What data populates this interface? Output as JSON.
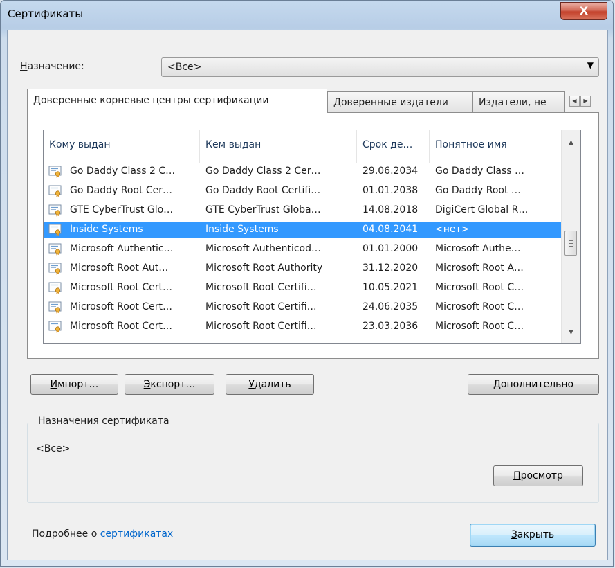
{
  "window": {
    "title": "Сертификаты",
    "close_label": "X"
  },
  "purpose": {
    "label_first": "Н",
    "label_rest": "азначение:",
    "selected": "<Все>"
  },
  "tabs": [
    {
      "label": "Доверенные корневые центры сертификации",
      "active": true
    },
    {
      "label": "Доверенные издатели",
      "active": false
    },
    {
      "label": "Издатели, не",
      "active": false
    }
  ],
  "list": {
    "columns": [
      "Кому выдан",
      "Кем выдан",
      "Срок де…",
      "Понятное имя"
    ],
    "rows": [
      {
        "issued_to": "Go Daddy Class 2 C…",
        "issued_by": "Go Daddy Class 2 Cer…",
        "expires": "29.06.2034",
        "name": "Go Daddy Class …",
        "selected": false
      },
      {
        "issued_to": "Go Daddy Root Cer…",
        "issued_by": "Go Daddy Root Certifi…",
        "expires": "01.01.2038",
        "name": "Go Daddy Root …",
        "selected": false
      },
      {
        "issued_to": "GTE CyberTrust Glo…",
        "issued_by": "GTE CyberTrust Globa…",
        "expires": "14.08.2018",
        "name": "DigiCert Global R…",
        "selected": false
      },
      {
        "issued_to": "Inside Systems",
        "issued_by": "Inside Systems",
        "expires": "04.08.2041",
        "name": "<нет>",
        "selected": true
      },
      {
        "issued_to": "Microsoft Authentic…",
        "issued_by": "Microsoft Authenticod…",
        "expires": "01.01.2000",
        "name": "Microsoft Authe…",
        "selected": false
      },
      {
        "issued_to": "Microsoft Root Aut…",
        "issued_by": "Microsoft Root Authority",
        "expires": "31.12.2020",
        "name": "Microsoft Root A…",
        "selected": false
      },
      {
        "issued_to": "Microsoft Root Cert…",
        "issued_by": "Microsoft Root Certifi…",
        "expires": "10.05.2021",
        "name": "Microsoft Root C…",
        "selected": false
      },
      {
        "issued_to": "Microsoft Root Cert…",
        "issued_by": "Microsoft Root Certifi…",
        "expires": "24.06.2035",
        "name": "Microsoft Root C…",
        "selected": false
      },
      {
        "issued_to": "Microsoft Root Cert…",
        "issued_by": "Microsoft Root Certifi…",
        "expires": "23.03.2036",
        "name": "Microsoft Root C…",
        "selected": false
      }
    ]
  },
  "buttons": {
    "import": {
      "first": "И",
      "rest": "мпорт…"
    },
    "export": {
      "first": "Э",
      "rest": "кспорт…"
    },
    "delete": {
      "first": "У",
      "rest": "далить"
    },
    "advanced": {
      "first": "Д",
      "rest": "ополнительно"
    },
    "view": {
      "first": "П",
      "rest": "росмотр"
    },
    "close": {
      "first": "З",
      "rest": "акрыть"
    }
  },
  "cert_purposes": {
    "title": "Назначения сертификата",
    "value": "<Все>"
  },
  "footer": {
    "prefix": "Подробнее о ",
    "link": "сертификатах"
  },
  "colors": {
    "selection": "#3399ff",
    "link": "#0066cc"
  }
}
